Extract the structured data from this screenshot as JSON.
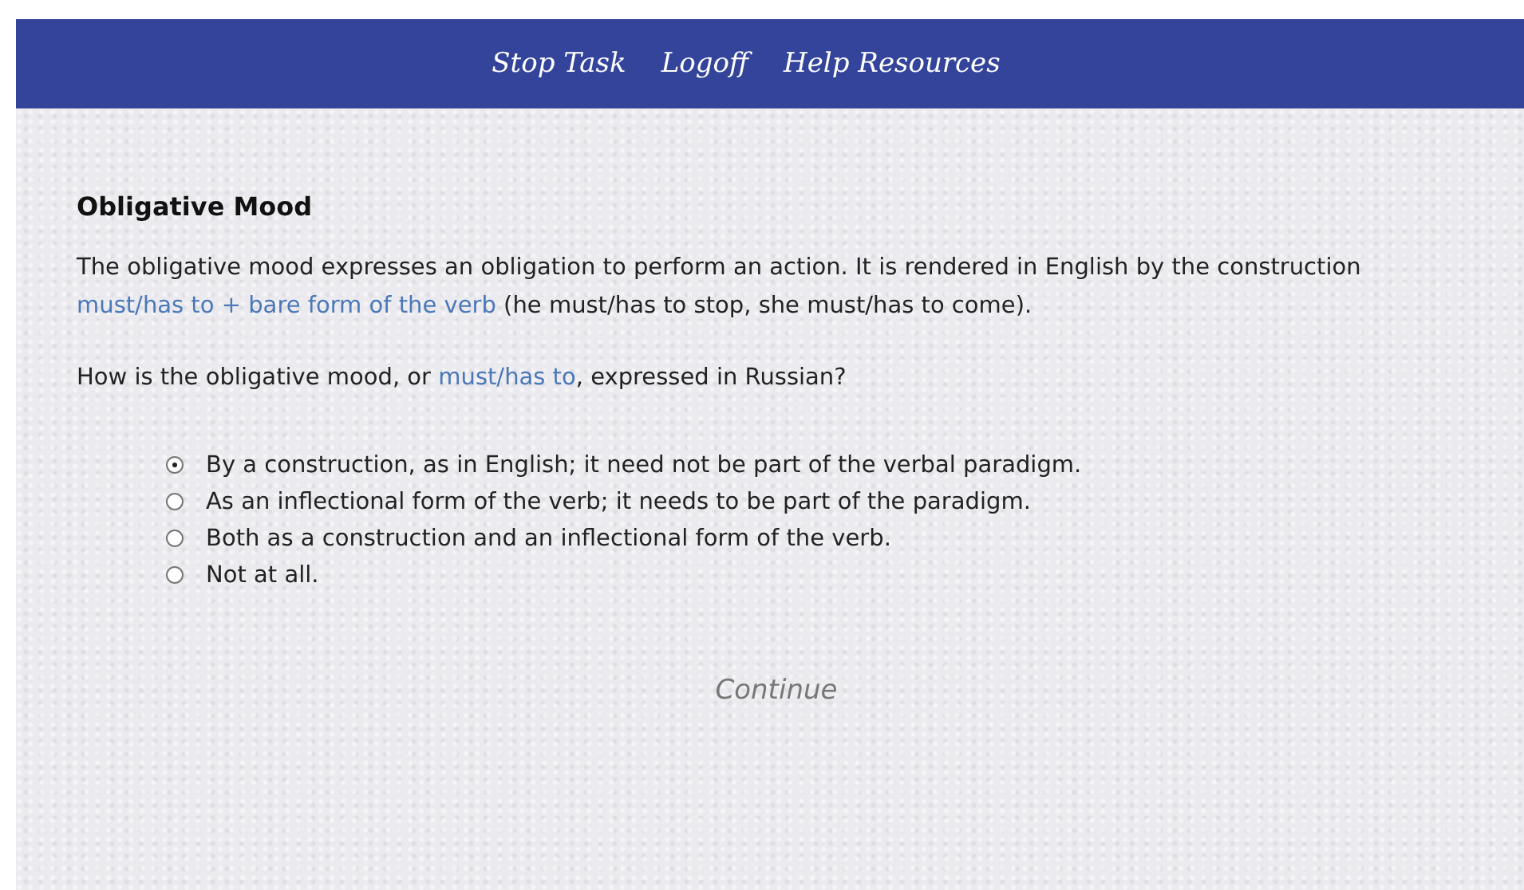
{
  "nav": {
    "links": [
      "Stop Task",
      "Logoff",
      "Help Resources"
    ]
  },
  "heading": "Obligative Mood",
  "intro": [
    {
      "kind": "text",
      "text": "The obligative mood expresses an obligation to perform an action. It is rendered in English by the construction "
    },
    {
      "kind": "term",
      "text": "must/has to + bare form of the verb"
    },
    {
      "kind": "text",
      "text": " (he must/has to stop, she must/has to come)."
    }
  ],
  "question": [
    {
      "kind": "text",
      "text": "How is the obligative mood, or "
    },
    {
      "kind": "term",
      "text": "must/has to"
    },
    {
      "kind": "text",
      "text": ", expressed in Russian?"
    }
  ],
  "options": [
    {
      "label": "By a construction, as in English; it need not be part of the verbal paradigm.",
      "selected": true
    },
    {
      "label": "As an inflectional form of the verb; it needs to be part of the paradigm.",
      "selected": false
    },
    {
      "label": "Both as a construction and an inflectional form of the verb.",
      "selected": false
    },
    {
      "label": "Not at all.",
      "selected": false
    }
  ],
  "continue_button": {
    "label": "Continue",
    "disabled": true
  }
}
